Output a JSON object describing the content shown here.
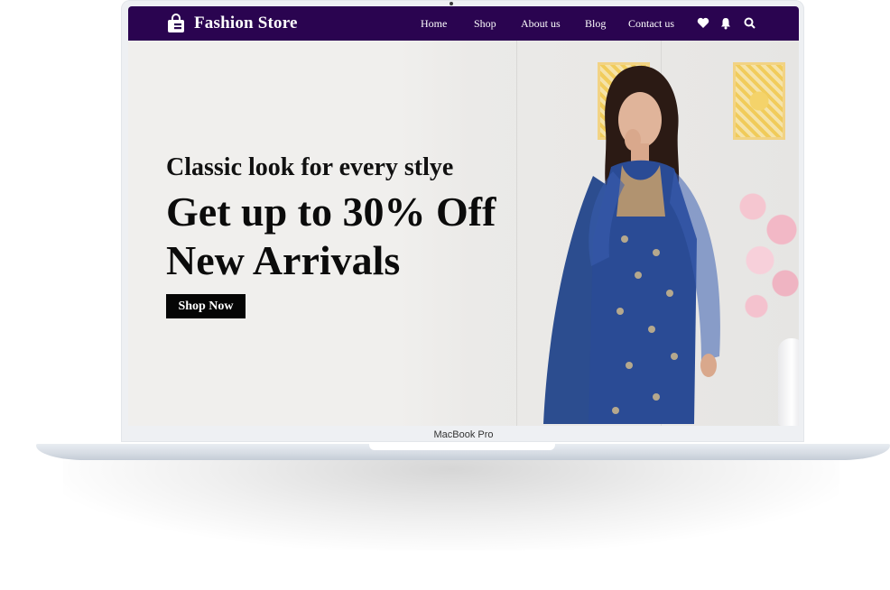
{
  "device": {
    "label": "MacBook Pro"
  },
  "navbar": {
    "brand": "Fashion Store",
    "links": [
      "Home",
      "Shop",
      "About us",
      "Blog",
      "Contact us"
    ],
    "icons": [
      "heart-icon",
      "bell-icon",
      "search-icon"
    ],
    "background": "#2a0450"
  },
  "hero": {
    "subtitle": "Classic look for every stlye",
    "headline_line1": "Get up to 30% Off",
    "headline_line2": "New Arrivals",
    "cta": "Shop Now"
  }
}
